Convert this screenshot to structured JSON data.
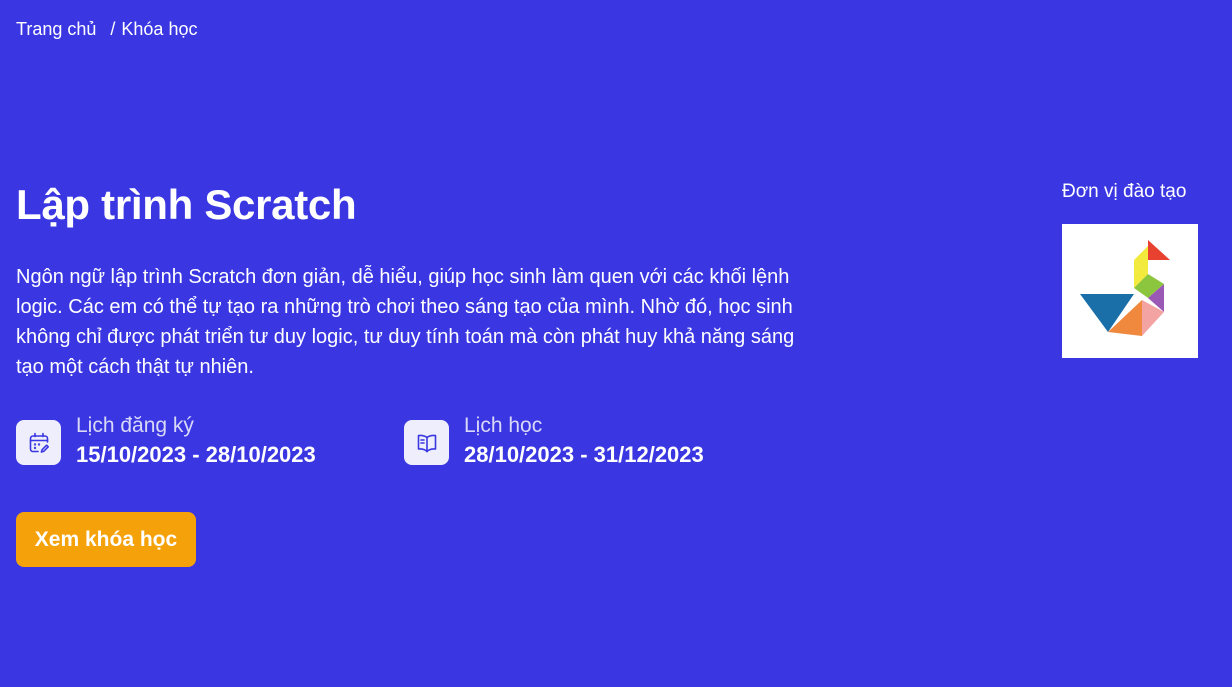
{
  "breadcrumb": {
    "home": "Trang chủ",
    "separator": "/",
    "current": "Khóa học"
  },
  "course": {
    "title": "Lập trình Scratch",
    "description": "Ngôn ngữ lập trình Scratch đơn giản, dễ hiểu, giúp học sinh làm quen với các khối lệnh logic. Các em có thể tự tạo ra những trò chơi theo sáng tạo của mình. Nhờ đó, học sinh không chỉ được phát triển tư duy logic, tư duy tính toán mà còn phát huy khả năng sáng tạo một cách thật tự nhiên."
  },
  "registration": {
    "icon": "calendar-edit-icon",
    "label": "Lịch đăng ký",
    "value": "15/10/2023 - 28/10/2023"
  },
  "schedule": {
    "icon": "book-open-icon",
    "label": "Lịch học",
    "value": "28/10/2023 - 31/12/2023"
  },
  "cta": {
    "label": "Xem khóa học"
  },
  "training_unit": {
    "label": "Đơn vị đào tạo",
    "logo": "tangram-bird-logo"
  },
  "colors": {
    "background": "#3a37e2",
    "accent": "#f5a10a",
    "icon_bg": "#eeeefc",
    "icon_stroke": "#3a37e2"
  }
}
